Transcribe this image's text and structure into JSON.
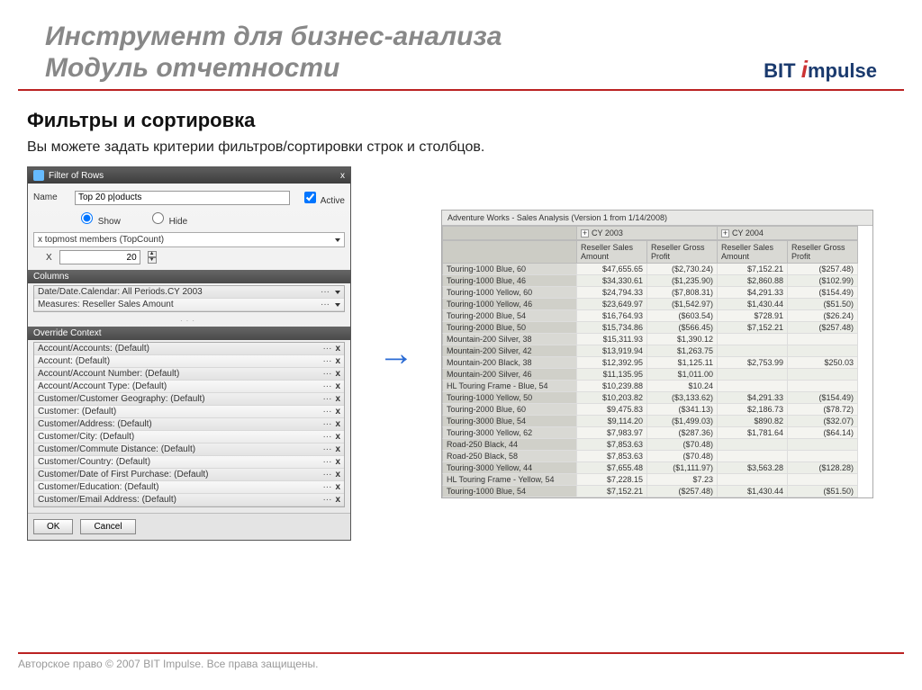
{
  "header": {
    "title_line1": "Инструмент для бизнес-анализа",
    "title_line2": "Модуль отчетности",
    "logo_prefix": "BIT",
    "logo_i": "i",
    "logo_rest": "mpulse"
  },
  "section": {
    "heading": "Фильтры и сортировка",
    "description": "Вы можете задать критерии фильтров/сортировки строк и столбцов."
  },
  "dialog": {
    "title": "Filter of Rows",
    "close": "x",
    "name_label": "Name",
    "name_value": "Top 20 p|oducts",
    "active_label": "Active",
    "show_label": "Show",
    "hide_label": "Hide",
    "method": "x topmost members (TopCount)",
    "x_label": "X",
    "x_value": "20",
    "columns_hdr": "Columns",
    "columns": [
      "Date/Date.Calendar: All Periods.CY 2003",
      "Measures: Reseller Sales Amount"
    ],
    "override_hdr": "Override Context",
    "overrides": [
      "Account/Accounts: (Default)",
      "Account: (Default)",
      "Account/Account Number: (Default)",
      "Account/Account Type: (Default)",
      "Customer/Customer Geography: (Default)",
      "Customer: (Default)",
      "Customer/Address: (Default)",
      "Customer/City: (Default)",
      "Customer/Commute Distance: (Default)",
      "Customer/Country: (Default)",
      "Customer/Date of First Purchase: (Default)",
      "Customer/Education: (Default)",
      "Customer/Email Address: (Default)"
    ],
    "ok": "OK",
    "cancel": "Cancel",
    "dots": "···",
    "x_glyph": "x"
  },
  "arrow": "→",
  "report": {
    "title": "Adventure Works - Sales Analysis (Version 1 from 1/14/2008)",
    "year1": "CY 2003",
    "year2": "CY 2004",
    "cols": [
      "Reseller Sales Amount",
      "Reseller Gross Profit",
      "Reseller Sales Amount",
      "Reseller Gross Profit"
    ],
    "rows": [
      {
        "l": "Touring-1000 Blue, 60",
        "c": [
          "$47,655.65",
          "($2,730.24)",
          "$7,152.21",
          "($257.48)"
        ]
      },
      {
        "l": "Touring-1000 Blue, 46",
        "c": [
          "$34,330.61",
          "($1,235.90)",
          "$2,860.88",
          "($102.99)"
        ]
      },
      {
        "l": "Touring-1000 Yellow, 60",
        "c": [
          "$24,794.33",
          "($7,808.31)",
          "$4,291.33",
          "($154.49)"
        ]
      },
      {
        "l": "Touring-1000 Yellow, 46",
        "c": [
          "$23,649.97",
          "($1,542.97)",
          "$1,430.44",
          "($51.50)"
        ]
      },
      {
        "l": "Touring-2000 Blue, 54",
        "c": [
          "$16,764.93",
          "($603.54)",
          "$728.91",
          "($26.24)"
        ]
      },
      {
        "l": "Touring-2000 Blue, 50",
        "c": [
          "$15,734.86",
          "($566.45)",
          "$7,152.21",
          "($257.48)"
        ]
      },
      {
        "l": "Mountain-200 Silver, 38",
        "c": [
          "$15,311.93",
          "$1,390.12",
          "",
          ""
        ]
      },
      {
        "l": "Mountain-200 Silver, 42",
        "c": [
          "$13,919.94",
          "$1,263.75",
          "",
          ""
        ]
      },
      {
        "l": "Mountain-200 Black, 38",
        "c": [
          "$12,392.95",
          "$1,125.11",
          "$2,753.99",
          "$250.03"
        ]
      },
      {
        "l": "Mountain-200 Silver, 46",
        "c": [
          "$11,135.95",
          "$1,011.00",
          "",
          ""
        ]
      },
      {
        "l": "HL Touring Frame - Blue, 54",
        "c": [
          "$10,239.88",
          "$10.24",
          "",
          ""
        ]
      },
      {
        "l": "Touring-1000 Yellow, 50",
        "c": [
          "$10,203.82",
          "($3,133.62)",
          "$4,291.33",
          "($154.49)"
        ]
      },
      {
        "l": "Touring-2000 Blue, 60",
        "c": [
          "$9,475.83",
          "($341.13)",
          "$2,186.73",
          "($78.72)"
        ]
      },
      {
        "l": "Touring-3000 Blue, 54",
        "c": [
          "$9,114.20",
          "($1,499.03)",
          "$890.82",
          "($32.07)"
        ]
      },
      {
        "l": "Touring-3000 Yellow, 62",
        "c": [
          "$7,983.97",
          "($287.36)",
          "$1,781.64",
          "($64.14)"
        ]
      },
      {
        "l": "Road-250 Black, 44",
        "c": [
          "$7,853.63",
          "($70.48)",
          "",
          ""
        ]
      },
      {
        "l": "Road-250 Black, 58",
        "c": [
          "$7,853.63",
          "($70.48)",
          "",
          ""
        ]
      },
      {
        "l": "Touring-3000 Yellow, 44",
        "c": [
          "$7,655.48",
          "($1,111.97)",
          "$3,563.28",
          "($128.28)"
        ]
      },
      {
        "l": "HL Touring Frame - Yellow, 54",
        "c": [
          "$7,228.15",
          "$7.23",
          "",
          ""
        ]
      },
      {
        "l": "Touring-1000 Blue, 54",
        "c": [
          "$7,152.21",
          "($257.48)",
          "$1,430.44",
          "($51.50)"
        ]
      }
    ]
  },
  "footer": "Авторское право © 2007 BIT Impulse. Все права защищены."
}
